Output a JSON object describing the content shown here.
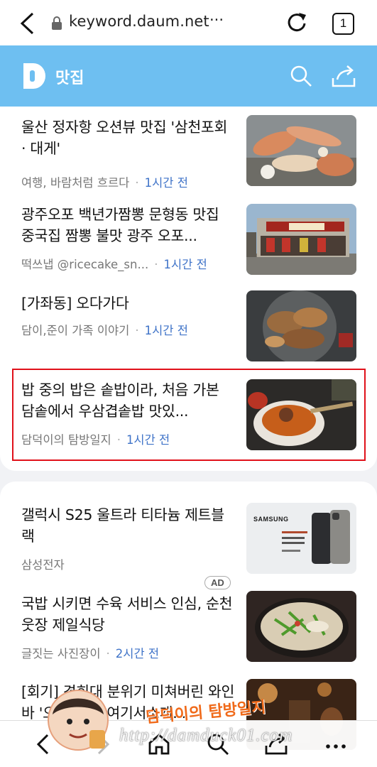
{
  "browser": {
    "url": "keyword.daum.net",
    "url_more": "···",
    "tab_count": "1"
  },
  "header": {
    "title": "맛집"
  },
  "articles": [
    {
      "title": "울산 정자항 오션뷰 맛집 '삼천포회 · 대게'",
      "source": "여행, 바람처럼 흐르다",
      "time": "1시간 전",
      "thumb": "crab"
    },
    {
      "title": "광주오포 백년가짬뽕 문형동 맛집 중국집 짬뽕 불맛 광주 오포...",
      "source": "떡쓰냅 @ricecake_sn...",
      "time": "1시간 전",
      "thumb": "restaurant"
    },
    {
      "title": "[가좌동] 오다가다",
      "source": "담이,준이 가족 이야기",
      "time": "1시간 전",
      "thumb": "grill"
    },
    {
      "title": "밥 중의 밥은 솥밥이라, 처음 가본 담솥에서 우삼겹솥밥 맛있...",
      "source": "담덕이의 탐방일지",
      "time": "1시간 전",
      "thumb": "soup"
    }
  ],
  "ad": {
    "title": "갤럭시 S25 울트라 티타늄 제트블랙",
    "source": "삼성전자",
    "badge": "AD",
    "brand": "SAMSUNG"
  },
  "articles2": [
    {
      "title": "국밥 시키면 수육 서비스 인심, 순천웃장 제일식당",
      "source": "글짓는 사진장이",
      "time": "2시간 전",
      "thumb": "gukbap"
    },
    {
      "title": "[회기] 경희대 분위기 미쳐버린 와인바 '오르비' + 여기서소개...",
      "source": "",
      "time": "",
      "thumb": "winebar"
    }
  ],
  "watermark": {
    "title": "담덕이의 탐방일지",
    "url": "http://damduck01.com"
  },
  "colors": {
    "header_bg": "#6ebff1",
    "time_blue": "#3f73c8",
    "highlight_red": "#e0111a"
  }
}
